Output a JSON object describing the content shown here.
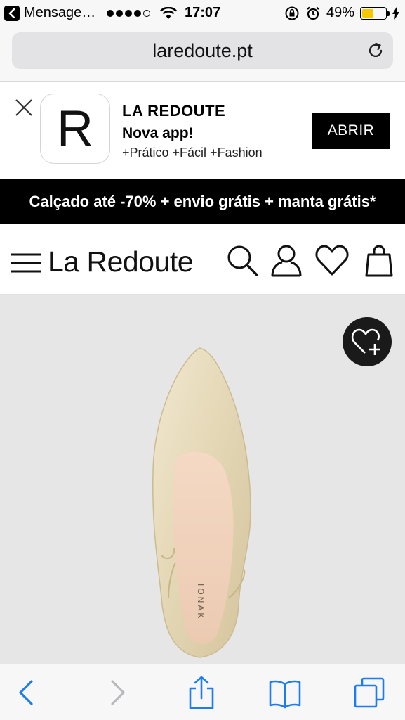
{
  "status_bar": {
    "carrier": "Mensage…",
    "time": "17:07",
    "battery": "49%",
    "battery_level": 0.49
  },
  "browser": {
    "url": "laredoute.pt"
  },
  "app_banner": {
    "icon_letter": "R",
    "app_name": "LA REDOUTE",
    "subtitle": "Nova app!",
    "tagline": "+Prático +Fácil +Fashion",
    "open_label": "ABRIR"
  },
  "promo": {
    "text": "Calçado até -70% + envio grátis + manta grátis*"
  },
  "header": {
    "logo": "La Redoute"
  },
  "product": {
    "shoe_brand_mark": "IONAK"
  },
  "colors": {
    "accent": "#000000",
    "battery": "#f5c800",
    "ios_blue": "#1e7cf2",
    "product_bg": "#e6e6e6"
  }
}
